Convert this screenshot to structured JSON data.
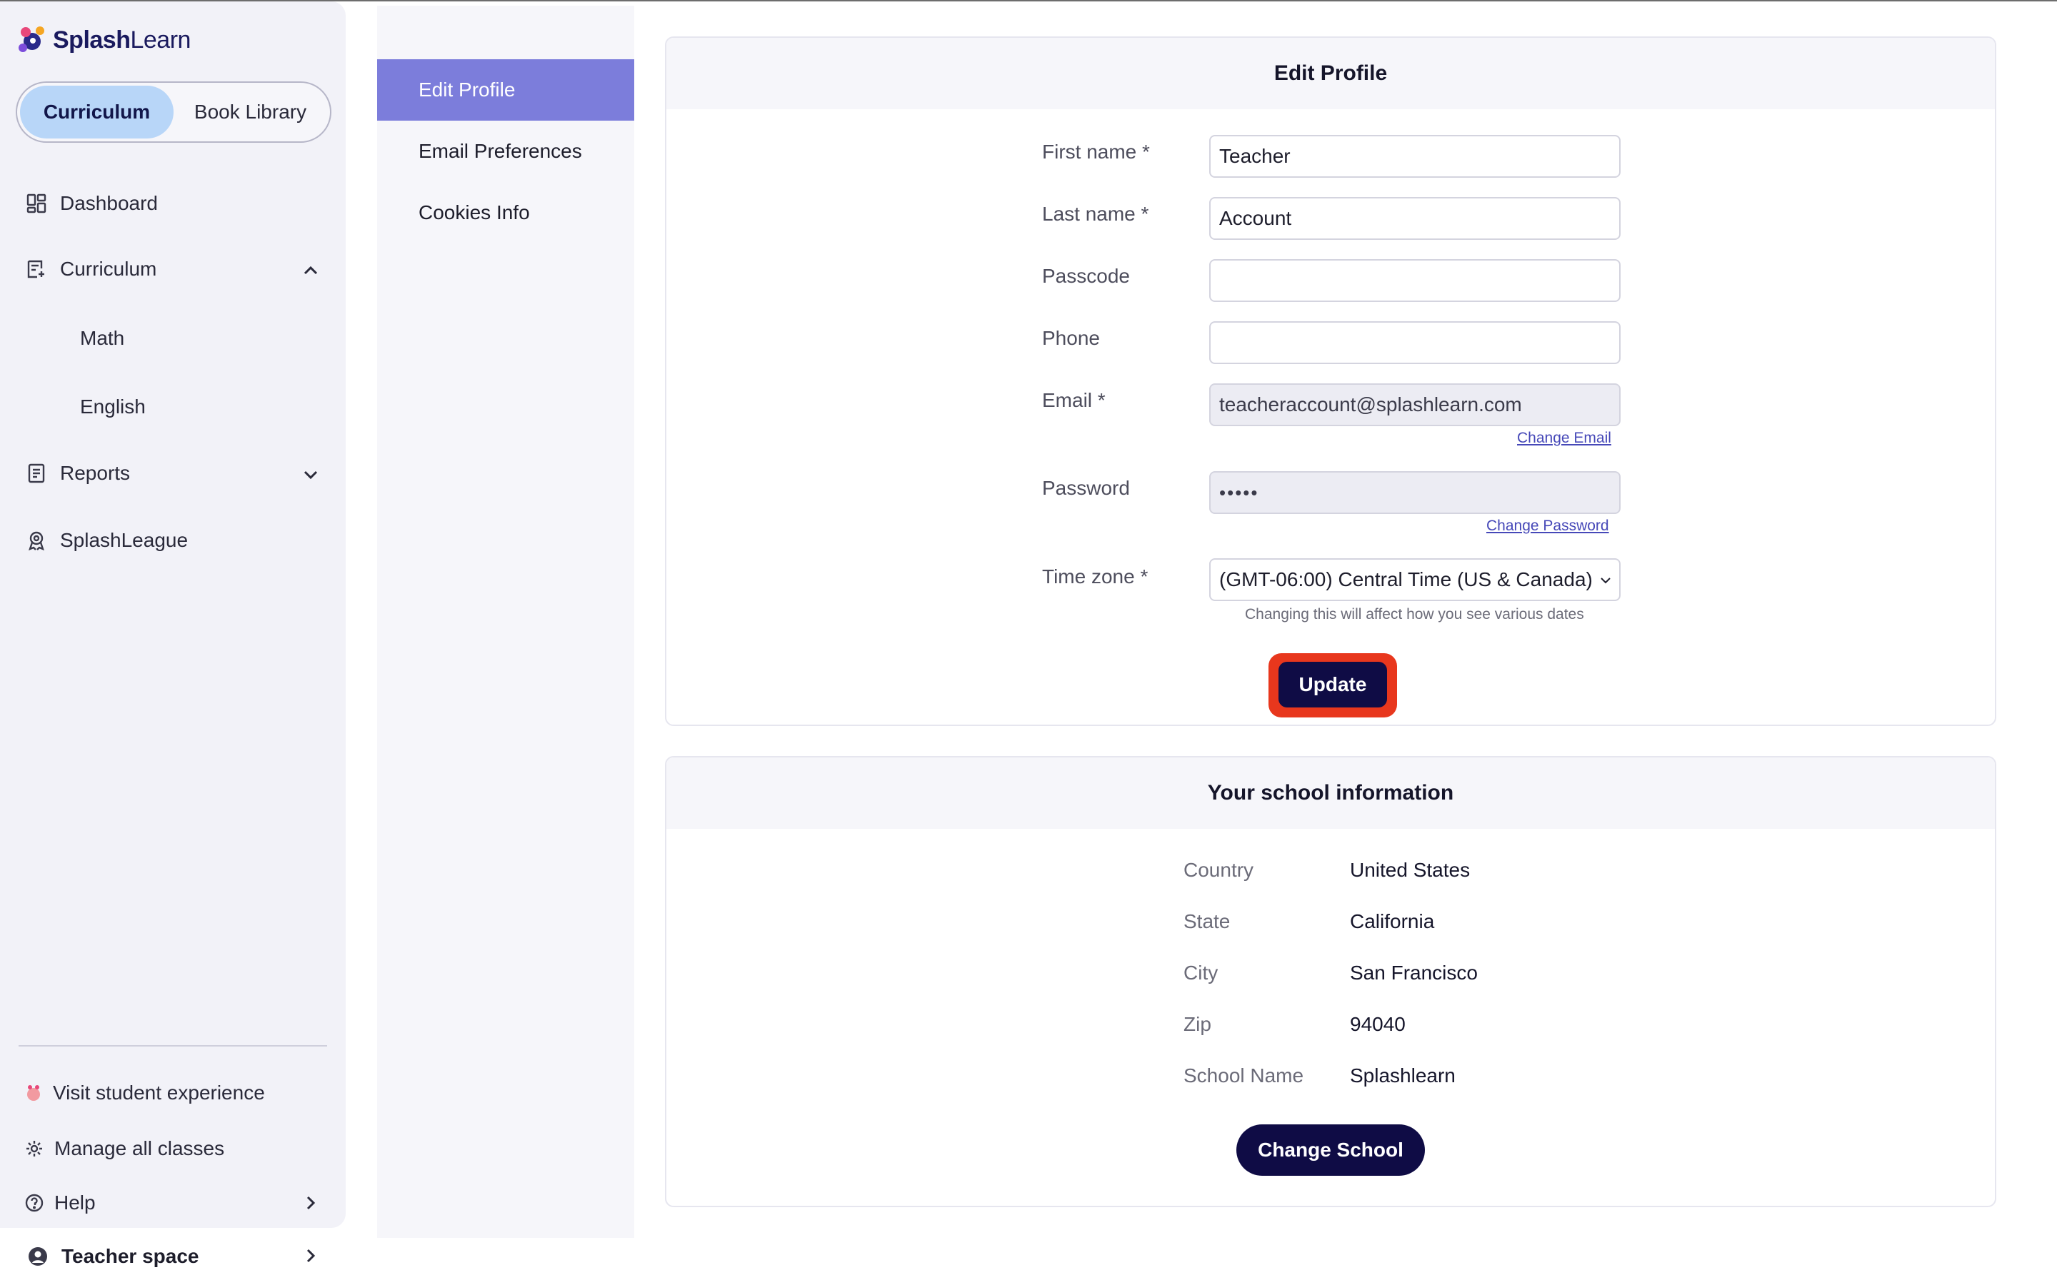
{
  "app": {
    "name_bold": "Splash",
    "name_light": "Learn"
  },
  "sidebar": {
    "segment": {
      "active": "Curriculum",
      "inactive": "Book Library"
    },
    "nav": {
      "dashboard": "Dashboard",
      "curriculum": "Curriculum",
      "math": "Math",
      "english": "English",
      "reports": "Reports",
      "splashleague": "SplashLeague"
    },
    "footer": {
      "visit_student": "Visit student experience",
      "manage_classes": "Manage all classes",
      "help": "Help",
      "teacher_space": "Teacher space"
    }
  },
  "settings_menu": [
    {
      "label": "Edit Profile",
      "active": true
    },
    {
      "label": "Email Preferences",
      "active": false
    },
    {
      "label": "Cookies Info",
      "active": false
    }
  ],
  "edit_profile": {
    "title": "Edit Profile",
    "fields": {
      "first_name": {
        "label": "First name *",
        "value": "Teacher"
      },
      "last_name": {
        "label": "Last name *",
        "value": "Account"
      },
      "passcode": {
        "label": "Passcode",
        "value": ""
      },
      "phone": {
        "label": "Phone",
        "value": ""
      },
      "email": {
        "label": "Email *",
        "value": "teacheraccount@splashlearn.com",
        "link": "Change Email"
      },
      "password": {
        "label": "Password",
        "value": "•••••",
        "link": "Change Password"
      },
      "timezone": {
        "label": "Time zone *",
        "value": "(GMT-06:00) Central Time (US & Canada)",
        "hint": "Changing this will affect how you see various dates"
      }
    },
    "update_label": "Update"
  },
  "school_info": {
    "title": "Your school information",
    "rows": [
      {
        "label": "Country",
        "value": "United States"
      },
      {
        "label": "State",
        "value": "California"
      },
      {
        "label": "City",
        "value": "San Francisco"
      },
      {
        "label": "Zip",
        "value": "94040"
      },
      {
        "label": "School Name",
        "value": "Splashlearn"
      }
    ],
    "change_school_label": "Change School"
  },
  "colors": {
    "accent": "#7c7ddb",
    "primary_button": "#0f0c45",
    "highlight_ring": "#e8371d",
    "segment_active": "#b8d6f8"
  }
}
